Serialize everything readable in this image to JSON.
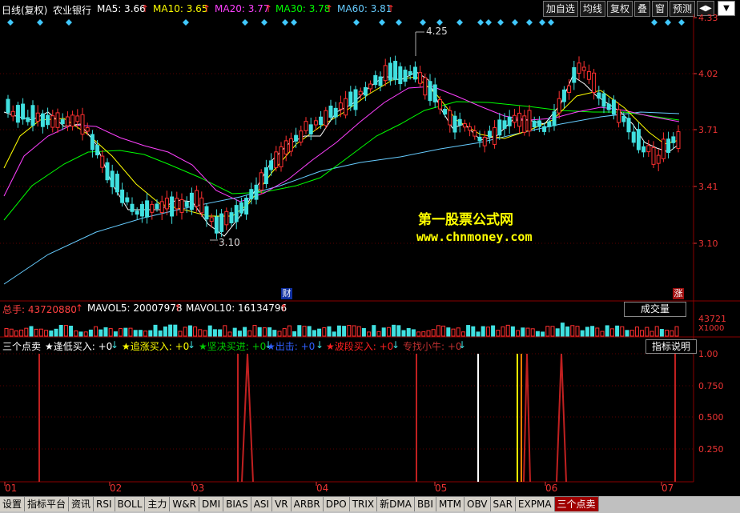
{
  "header": {
    "period": "日线(复权)",
    "stock_name": "农业银行",
    "ma": [
      {
        "label": "MA5: 3.66",
        "color": "#ffffff"
      },
      {
        "label": "MA10: 3.65",
        "color": "#ffff00"
      },
      {
        "label": "MA20: 3.77",
        "color": "#ff40ff"
      },
      {
        "label": "MA30: 3.78",
        "color": "#00ff00"
      },
      {
        "label": "MA60: 3.81",
        "color": "#66ccff"
      }
    ]
  },
  "toolbar": {
    "buttons": [
      "加自选",
      "均线",
      "复权",
      "叠",
      "窗",
      "预测"
    ],
    "nav_symbol": "◀▶",
    "dropdown_symbol": "▼"
  },
  "price_axis": [
    "4.33",
    "4.02",
    "3.71",
    "3.41",
    "3.10"
  ],
  "annotations": {
    "high": "4.25",
    "low": "3.10",
    "cai": "财",
    "zhang": "涨"
  },
  "watermark": {
    "title": "第一股票公式网",
    "url": "www.chnmoney.com"
  },
  "volume": {
    "label": "总手: 43720880",
    "mavol5": "MAVOL5: 20007978",
    "mavol10": "MAVOL10: 16134796",
    "select_value": "成交量",
    "axis_top": "43721",
    "axis_unit": "X1000"
  },
  "signals": {
    "title": "三个点卖",
    "items": [
      {
        "label": "★逢低买入: +0",
        "color": "#ffffff"
      },
      {
        "label": "★追涨买入: +0",
        "color": "#ffff00"
      },
      {
        "label": "★坚决买进: +0",
        "color": "#00cc00"
      },
      {
        "label": "★出击: +0",
        "color": "#3060ff"
      },
      {
        "label": "★波段买入: +0",
        "color": "#ff2020"
      },
      {
        "label": "专找小牛: +0",
        "color": "#c03030"
      }
    ],
    "help_button": "指标说明",
    "axis": [
      "1.00",
      "0.750",
      "0.500",
      "0.250"
    ]
  },
  "x_axis": [
    "01",
    "02",
    "03",
    "04",
    "05",
    "06",
    "07"
  ],
  "tabs": [
    "设置",
    "指标平台",
    "资讯",
    "RSI",
    "BOLL",
    "主力",
    "W&R",
    "DMI",
    "BIAS",
    "ASI",
    "VR",
    "ARBR",
    "DPO",
    "TRIX",
    "新DMA",
    "BBI",
    "MTM",
    "OBV",
    "SAR",
    "EXPMA",
    "三个点卖"
  ],
  "active_tab": "三个点卖",
  "colors": {
    "up": "#ff3030",
    "down": "#40e0e0",
    "grid": "#8a0000",
    "axis_text": "#ff3333"
  }
}
